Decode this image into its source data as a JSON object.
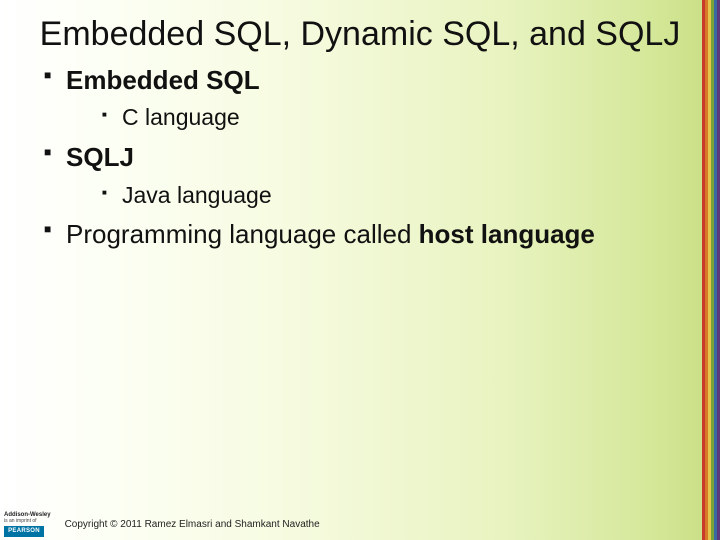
{
  "title": "Embedded SQL, Dynamic SQL, and SQLJ",
  "bullets": {
    "b1": {
      "head": "Embedded SQL",
      "sub": "C language"
    },
    "b2": {
      "head": "SQLJ",
      "sub": "Java language"
    },
    "b3": {
      "pre": "Programming language called ",
      "bold": "host language"
    }
  },
  "footer": {
    "brand_top": "Addison-Wesley",
    "brand_sub": "is an imprint of",
    "pearson": "PEARSON",
    "copyright": "Copyright © 2011 Ramez Elmasri and Shamkant Navathe"
  }
}
